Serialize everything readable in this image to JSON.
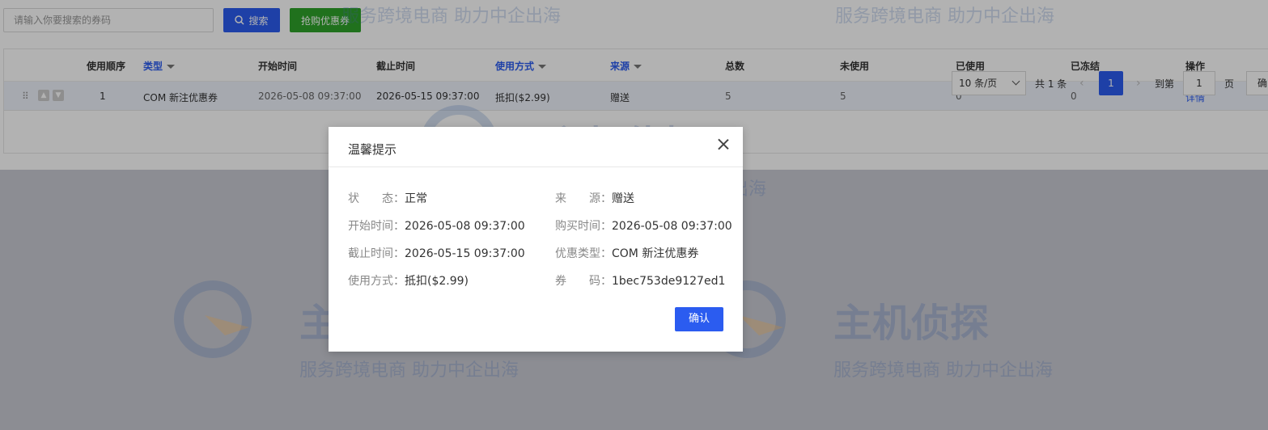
{
  "toolbar": {
    "search_placeholder": "请输入你要搜索的券码",
    "search_label": "搜索",
    "grab_label": "抢购优惠券"
  },
  "table": {
    "headers": [
      "使用顺序",
      "类型",
      "开始时间",
      "截止时间",
      "使用方式",
      "来源",
      "总数",
      "未使用",
      "已使用",
      "已冻结",
      "操作"
    ],
    "row": {
      "order": "1",
      "type": "COM 新注优惠券",
      "start": "2026-05-08 09:37:00",
      "end": "2026-05-15 09:37:00",
      "method": "抵扣($2.99)",
      "source": "赠送",
      "total": "5",
      "unused": "5",
      "used": "0",
      "frozen": "0",
      "action": "详情"
    }
  },
  "pager": {
    "per_page": "10 条/页",
    "total": "共 1 条",
    "current": "1",
    "goto_label": "到第",
    "goto_value": "1",
    "page_suffix": "页",
    "confirm": "确"
  },
  "watermark": {
    "brand": "主机侦探",
    "slogan": "服务跨境电商  助力中企出海"
  },
  "modal": {
    "title": "温馨提示",
    "fields": {
      "status_label": "状　　态：",
      "status_value": "正常",
      "source_label": "来　　源：",
      "source_value": "赠送",
      "start_label": "开始时间：",
      "start_value": "2026-05-08 09:37:00",
      "buy_label": "购买时间：",
      "buy_value": "2026-05-08 09:37:00",
      "end_label": "截止时间：",
      "end_value": "2026-05-15 09:37:00",
      "type_label": "优惠类型：",
      "type_value": "COM 新注优惠券",
      "method_label": "使用方式：",
      "method_value": "抵扣($2.99)",
      "code_label": "券　　码：",
      "code_value": "1bec753de9127ed1"
    },
    "confirm_label": "确认"
  },
  "colors": {
    "primary": "#2b5cf0",
    "success": "#2ea32a",
    "overlay": "rgba(0,0,0,0.3)"
  }
}
